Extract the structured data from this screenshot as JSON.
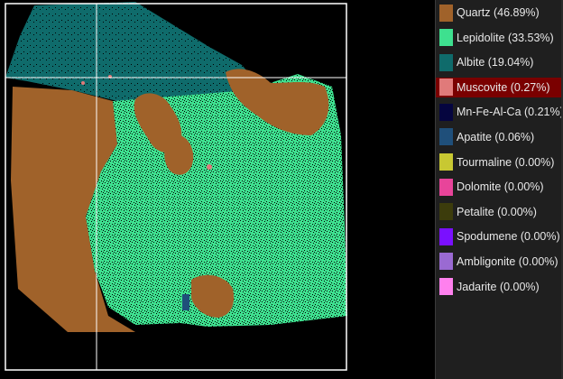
{
  "legend": {
    "items": [
      {
        "label": "Quartz (46.89%)",
        "color": "#a0622a",
        "name": "quartz",
        "selected": false
      },
      {
        "label": "Lepidolite (33.53%)",
        "color": "#3ee08f",
        "name": "lepidolite",
        "selected": false
      },
      {
        "label": "Albite (19.04%)",
        "color": "#0f6b6b",
        "name": "albite",
        "selected": false
      },
      {
        "label": "Muscovite (0.27%)",
        "color": "#e07a7a",
        "name": "muscovite",
        "selected": true
      },
      {
        "label": "Mn-Fe-Al-Ca (0.21%)",
        "color": "#05053f",
        "name": "mn-fe-al-ca",
        "selected": false
      },
      {
        "label": "Apatite (0.06%)",
        "color": "#1f4f7a",
        "name": "apatite",
        "selected": false
      },
      {
        "label": "Tourmaline (0.00%)",
        "color": "#c8c832",
        "name": "tourmaline",
        "selected": false
      },
      {
        "label": "Dolomite (0.00%)",
        "color": "#e8449a",
        "name": "dolomite",
        "selected": false
      },
      {
        "label": "Petalite (0.00%)",
        "color": "#3c3c0c",
        "name": "petalite",
        "selected": false
      },
      {
        "label": "Spodumene (0.00%)",
        "color": "#7a10ff",
        "name": "spodumene",
        "selected": false
      },
      {
        "label": "Ambligonite (0.00%)",
        "color": "#9a6ad2",
        "name": "ambligonite",
        "selected": false
      },
      {
        "label": "Jadarite (0.00%)",
        "color": "#ff80ee",
        "name": "jadarite",
        "selected": false
      }
    ]
  },
  "map": {
    "background_color": "#000000",
    "frame_color": "#ffffff"
  }
}
